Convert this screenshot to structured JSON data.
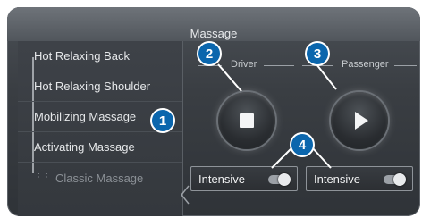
{
  "header": {
    "title": "Massage"
  },
  "menu": {
    "items": [
      {
        "label": "Hot Relaxing Back"
      },
      {
        "label": "Hot Relaxing Shoulder"
      },
      {
        "label": "Mobilizing Massage"
      },
      {
        "label": "Activating Massage"
      },
      {
        "label": "Classic Massage"
      }
    ]
  },
  "controls": {
    "driver_label": "Driver",
    "passenger_label": "Passenger",
    "driver_intensive_label": "Intensive",
    "passenger_intensive_label": "Intensive"
  },
  "callouts": [
    "1",
    "2",
    "3",
    "4"
  ],
  "icons": {
    "driver_button": "stop-icon",
    "passenger_button": "play-icon",
    "list_handle": "drag-dots-icon"
  },
  "colors": {
    "callout": "#0b66ad",
    "background": "#3a3e43"
  }
}
